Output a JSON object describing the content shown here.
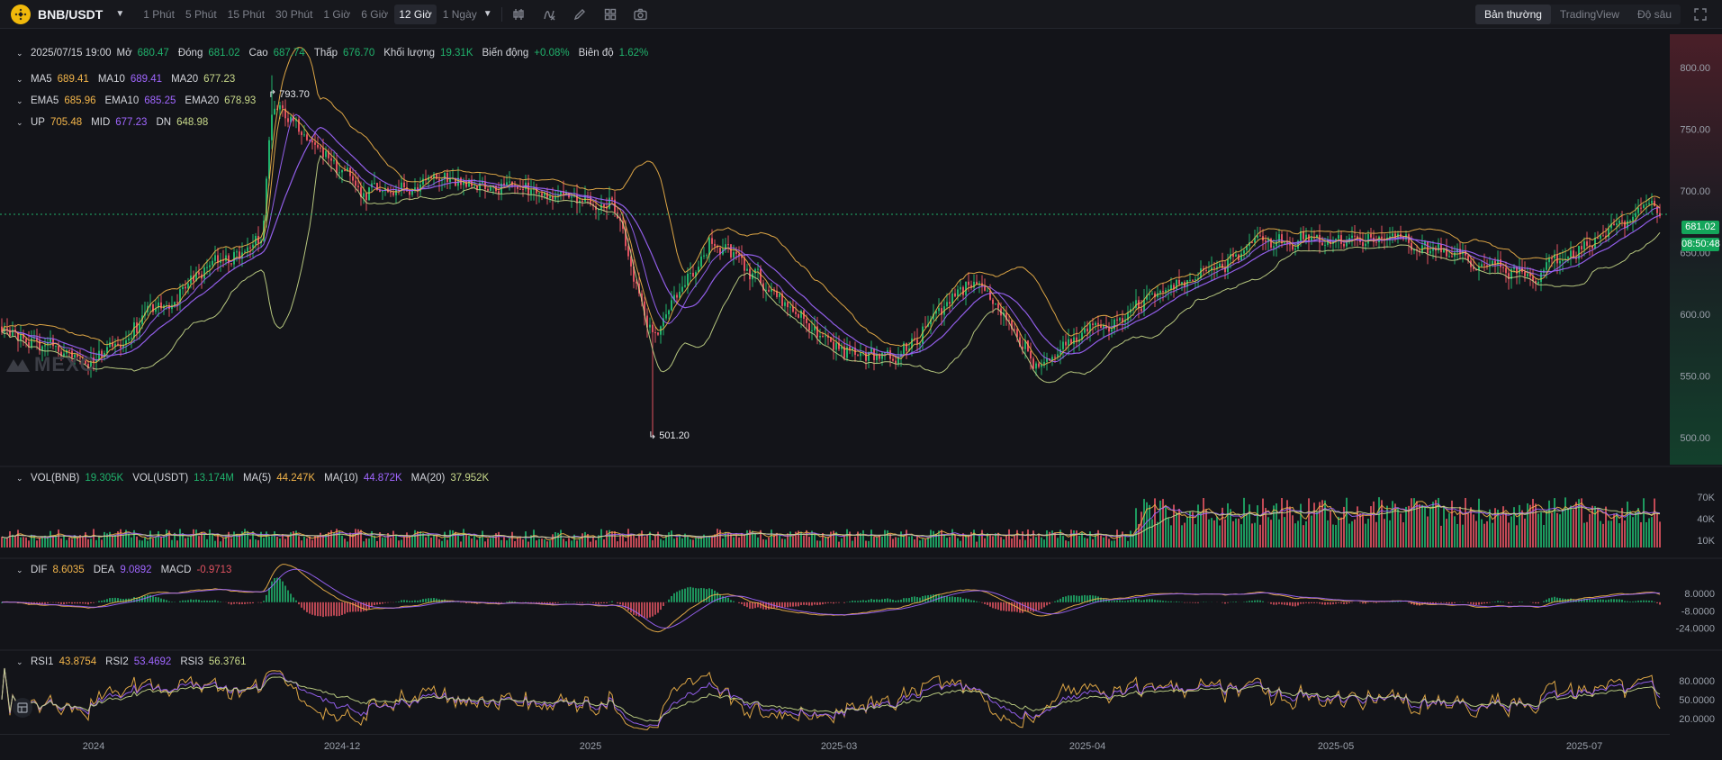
{
  "toolbar": {
    "symbol": "BNB/USDT",
    "intervals": [
      "1 Phút",
      "5 Phút",
      "15 Phút",
      "30 Phút",
      "1 Giờ",
      "6 Giờ",
      "12 Giờ",
      "1 Ngày"
    ],
    "active_interval": "12 Giờ",
    "tools": [
      "candle-type-icon",
      "indicator-icon",
      "draw-pencil-icon",
      "layout-grid-icon",
      "camera-icon"
    ],
    "views": [
      "Bản thường",
      "TradingView",
      "Độ sâu"
    ],
    "active_view": "Bản thường"
  },
  "ohlc": {
    "date": "2025/07/15 19:00",
    "open_label": "Mở",
    "open": "680.47",
    "close_label": "Đóng",
    "close": "681.02",
    "high_label": "Cao",
    "high": "687.74",
    "low_label": "Thấp",
    "low": "676.70",
    "volume_label": "Khối lượng",
    "volume": "19.31K",
    "change_label": "Biến động",
    "change": "+0.08%",
    "amplitude_label": "Biên độ",
    "amplitude": "1.62%"
  },
  "ma": {
    "ma5_label": "MA5",
    "ma5": "689.41",
    "ma10_label": "MA10",
    "ma10": "689.41",
    "ma20_label": "MA20",
    "ma20": "677.23"
  },
  "ema": {
    "ema5_label": "EMA5",
    "ema5": "685.96",
    "ema10_label": "EMA10",
    "ema10": "685.25",
    "ema20_label": "EMA20",
    "ema20": "678.93"
  },
  "boll": {
    "up_label": "UP",
    "up": "705.48",
    "mid_label": "MID",
    "mid": "677.23",
    "dn_label": "DN",
    "dn": "648.98"
  },
  "vol": {
    "bnb_label": "VOL(BNB)",
    "bnb": "19.305K",
    "usdt_label": "VOL(USDT)",
    "usdt": "13.174M",
    "ma5_label": "MA(5)",
    "ma5": "44.247K",
    "ma10_label": "MA(10)",
    "ma10": "44.872K",
    "ma20_label": "MA(20)",
    "ma20": "37.952K"
  },
  "macd": {
    "dif_label": "DIF",
    "dif": "8.6035",
    "dea_label": "DEA",
    "dea": "9.0892",
    "macd_label": "MACD",
    "macd": "-0.9713"
  },
  "rsi": {
    "rsi1_label": "RSI1",
    "rsi1": "43.8754",
    "rsi2_label": "RSI2",
    "rsi2": "53.4692",
    "rsi3_label": "RSI3",
    "rsi3": "56.3761"
  },
  "last_price": "681.02",
  "countdown": "08:50:48",
  "high_marker": "793.70",
  "low_marker": "501.20",
  "watermark": "MEXC",
  "colors": {
    "up": "#20b26c",
    "down": "#e05260",
    "ma5": "#f3b54a",
    "ma10": "#a066ff",
    "ma20": "#c8d98a",
    "bg": "#131419"
  },
  "chart_data": {
    "type": "candlestick",
    "pair": "BNB/USDT",
    "interval": "12 Giờ",
    "price_axis": {
      "ticks": [
        "800.00",
        "750.00",
        "700.00",
        "650.00",
        "600.00",
        "550.00",
        "500.00"
      ],
      "range": [
        478,
        827
      ]
    },
    "volume_axis": {
      "ticks": [
        "70K",
        "40K",
        "10K"
      ]
    },
    "macd_axis": {
      "ticks": [
        "8.0000",
        "-8.0000",
        "-24.0000"
      ]
    },
    "rsi_axis": {
      "ticks": [
        "80.0000",
        "50.0000",
        "20.0000"
      ]
    },
    "x_labels": [
      "2024",
      "2024-12",
      "2025",
      "2025-03",
      "2025-04",
      "2025-05",
      "2025-07"
    ],
    "approx_close_path": [
      {
        "x": "2024-10",
        "close": 590
      },
      {
        "x": "2024-10-20",
        "close": 560
      },
      {
        "x": "2024-11-10",
        "close": 640
      },
      {
        "x": "2024-11-30",
        "close": 660
      },
      {
        "x": "2024-12-04",
        "close": 770
      },
      {
        "x": "2024-12-20",
        "close": 700
      },
      {
        "x": "2025-01-05",
        "close": 710
      },
      {
        "x": "2025-01-25",
        "close": 690
      },
      {
        "x": "2025-02-03",
        "close": 580
      },
      {
        "x": "2025-02-18",
        "close": 660
      },
      {
        "x": "2025-03-01",
        "close": 570
      },
      {
        "x": "2025-03-10",
        "close": 560
      },
      {
        "x": "2025-03-20",
        "close": 630
      },
      {
        "x": "2025-04-07",
        "close": 560
      },
      {
        "x": "2025-04-25",
        "close": 605
      },
      {
        "x": "2025-05-12",
        "close": 660
      },
      {
        "x": "2025-06-01",
        "close": 660
      },
      {
        "x": "2025-06-22",
        "close": 630
      },
      {
        "x": "2025-07-05",
        "close": 660
      },
      {
        "x": "2025-07-13",
        "close": 690
      },
      {
        "x": "2025-07-15",
        "close": 681.02
      }
    ],
    "extremes": {
      "high": 793.7,
      "low": 501.2
    }
  }
}
